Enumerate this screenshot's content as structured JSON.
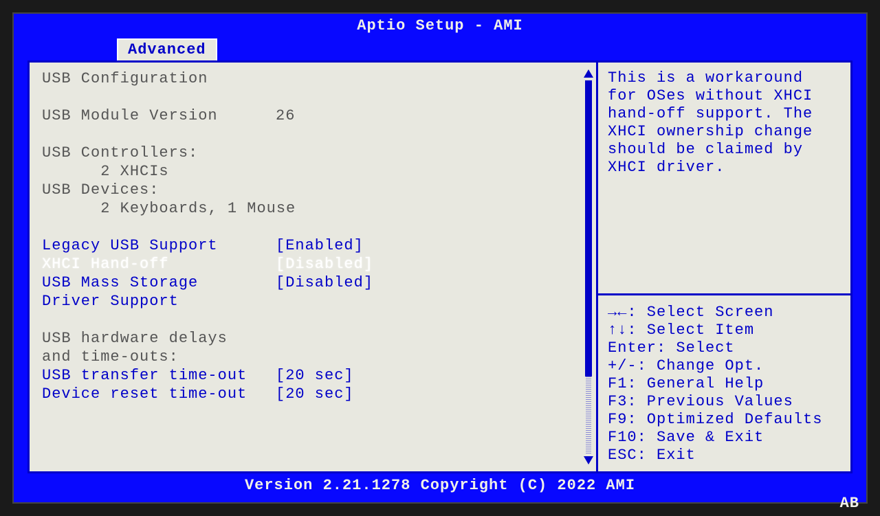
{
  "header": {
    "title": "Aptio Setup - AMI",
    "active_tab": "Advanced"
  },
  "main": {
    "section_title": "USB Configuration",
    "info": [
      {
        "label": "USB Module Version",
        "value": "26"
      }
    ],
    "controllers_label": "USB Controllers:",
    "controllers_value": "2 XHCIs",
    "devices_label": "USB Devices:",
    "devices_value": "2 Keyboards, 1 Mouse",
    "settings": [
      {
        "label": "Legacy USB Support",
        "value": "[Enabled]",
        "selected": false
      },
      {
        "label": "XHCI Hand-off",
        "value": "[Disabled]",
        "selected": true
      },
      {
        "label": "USB Mass Storage",
        "value": "[Disabled]",
        "selected": false
      },
      {
        "label": "Driver Support",
        "value": "",
        "selected": false
      }
    ],
    "delays_header1": "USB hardware delays",
    "delays_header2": "and time-outs:",
    "delays": [
      {
        "label": "USB transfer time-out",
        "value": "[20 sec]"
      },
      {
        "label": "Device reset time-out",
        "value": "[20 sec]"
      }
    ]
  },
  "help": {
    "text": "This is a workaround for OSes without XHCI hand-off support. The XHCI ownership change should be claimed by XHCI driver.",
    "keys": [
      "→←: Select Screen",
      "↑↓: Select Item",
      "Enter: Select",
      "+/-: Change Opt.",
      "F1: General Help",
      "F3: Previous Values",
      "F9: Optimized Defaults",
      "F10: Save & Exit",
      "ESC: Exit"
    ]
  },
  "footer": {
    "text": "Version 2.21.1278 Copyright (C) 2022 AMI",
    "corner": "AB"
  }
}
